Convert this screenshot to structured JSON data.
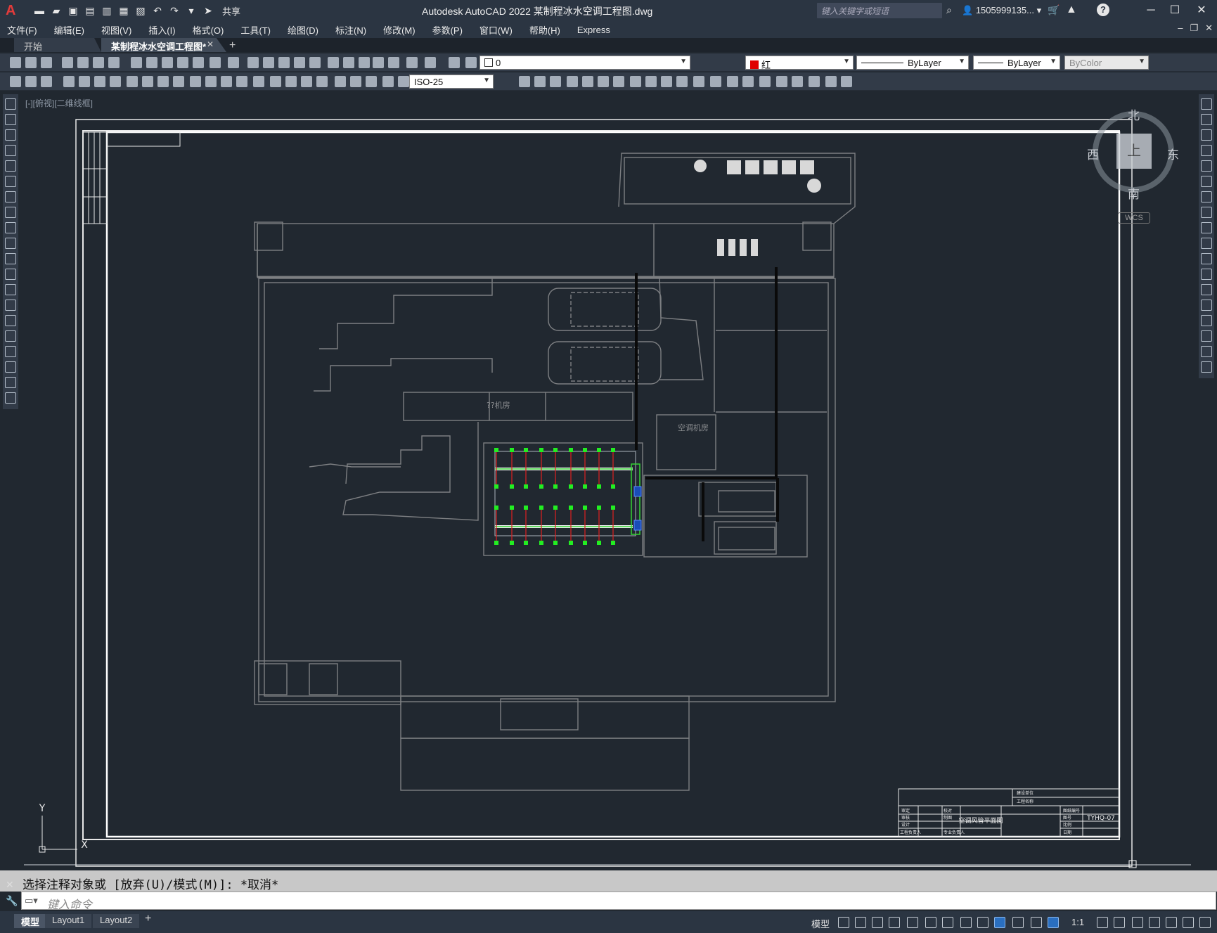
{
  "title_bar": {
    "app_logo": "A",
    "share_label": "共享",
    "window_title": "Autodesk AutoCAD 2022    某制程冰水空调工程图.dwg",
    "search_placeholder": "键入关键字或短语",
    "user": "1505999135...",
    "help": "?"
  },
  "menu": [
    "文件(F)",
    "编辑(E)",
    "视图(V)",
    "插入(I)",
    "格式(O)",
    "工具(T)",
    "绘图(D)",
    "标注(N)",
    "修改(M)",
    "参数(P)",
    "窗口(W)",
    "帮助(H)",
    "Express"
  ],
  "tabs": [
    {
      "label": "开始",
      "active": false
    },
    {
      "label": "某制程冰水空调工程图*",
      "active": true
    }
  ],
  "toolbar": {
    "layer_value": "0",
    "color_value": "红",
    "color_hex": "#e00000",
    "linetype_value": "ByLayer",
    "lineweight_value": "ByLayer",
    "plotstyle_value": "ByColor",
    "dimstyle_value": "ISO-25"
  },
  "viewport": {
    "label": "[-][俯视][二维线框]",
    "viewcube": {
      "north": "北",
      "south": "南",
      "east": "东",
      "west": "西",
      "face": "上"
    },
    "wcs": "WCS"
  },
  "drawing": {
    "title_block": {
      "drawing_title": "空调风管平面图",
      "drawing_number": "TYHQ-07",
      "labels": [
        "建设单位",
        "工程名称",
        "审定",
        "审核",
        "设计",
        "工程负责人",
        "校对",
        "制图",
        "专业负责人",
        "图纸编号",
        "图号",
        "比例",
        "日期"
      ]
    },
    "room_labels": [
      "??机房",
      "空调机房"
    ],
    "axis_y": "Y",
    "axis_x": "X"
  },
  "command": {
    "history": "选择注释对象或 [放弃(U)/模式(M)]: *取消*",
    "placeholder": "键入命令"
  },
  "status": {
    "layout_tabs": [
      "模型",
      "Layout1",
      "Layout2"
    ],
    "model_label": "模型",
    "scale": "1:1"
  }
}
